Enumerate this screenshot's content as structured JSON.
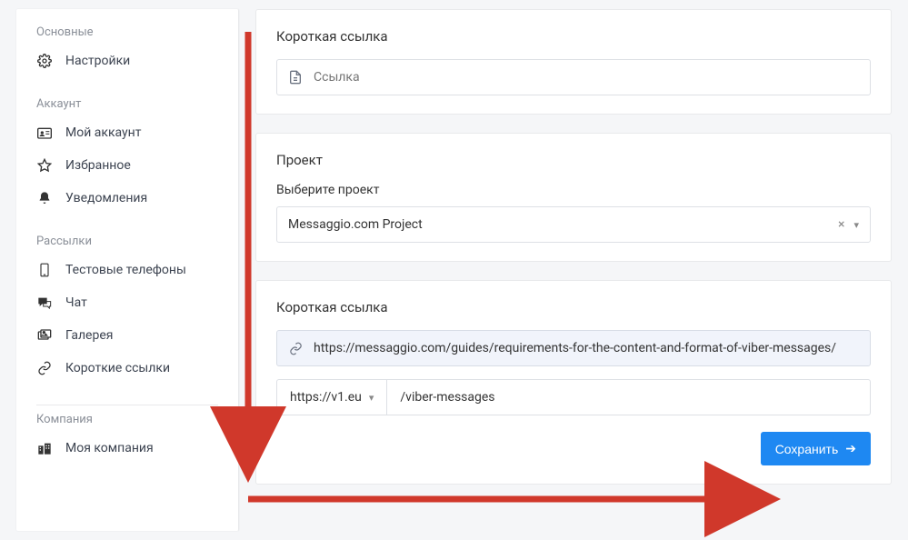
{
  "sidebar": {
    "sections": [
      {
        "title": "Основные",
        "items": [
          {
            "label": "Настройки",
            "icon": "gear"
          }
        ]
      },
      {
        "title": "Аккаунт",
        "items": [
          {
            "label": "Мой аккаунт",
            "icon": "id-card"
          },
          {
            "label": "Избранное",
            "icon": "star"
          },
          {
            "label": "Уведомления",
            "icon": "bell"
          }
        ]
      },
      {
        "title": "Рассылки",
        "items": [
          {
            "label": "Тестовые телефоны",
            "icon": "phone"
          },
          {
            "label": "Чат",
            "icon": "chat"
          },
          {
            "label": "Галерея",
            "icon": "gallery"
          },
          {
            "label": "Короткие ссылки",
            "icon": "link"
          }
        ]
      },
      {
        "title": "Компания",
        "items": [
          {
            "label": "Моя компания",
            "icon": "building"
          }
        ]
      }
    ]
  },
  "card_shortlink_top": {
    "title": "Короткая ссылка",
    "link_placeholder": "Ссылка"
  },
  "card_project": {
    "title": "Проект",
    "field_label": "Выберите проект",
    "selected": "Messaggio.com Project"
  },
  "card_shortlink_bottom": {
    "title": "Короткая ссылка",
    "full_url": "https://messaggio.com/guides/requirements-for-the-content-and-format-of-viber-messages/",
    "domain": "https://v1.eu",
    "slug": "/viber-messages"
  },
  "buttons": {
    "save": "Сохранить"
  },
  "colors": {
    "primary": "#1e88f2",
    "annotation": "#d0382b"
  }
}
